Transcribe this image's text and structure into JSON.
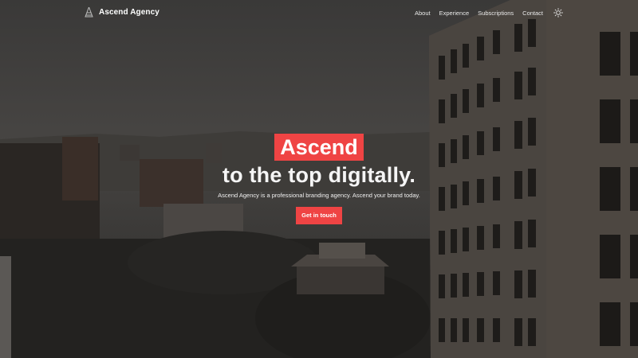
{
  "header": {
    "brand_name": "Ascend Agency",
    "nav": [
      {
        "label": "About"
      },
      {
        "label": "Experience"
      },
      {
        "label": "Subscriptions"
      },
      {
        "label": "Contact"
      }
    ],
    "theme_toggle_icon": "sun-icon",
    "brand_icon": "mountain-logo-icon"
  },
  "hero": {
    "highlight": "Ascend",
    "title": "to the top digitally.",
    "subtitle": "Ascend Agency is a professional branding agency. Ascend your brand today.",
    "cta_label": "Get in touch"
  },
  "colors": {
    "accent": "#ef4444",
    "text": "#ffffff",
    "background_tint": "#2e2d2b"
  }
}
